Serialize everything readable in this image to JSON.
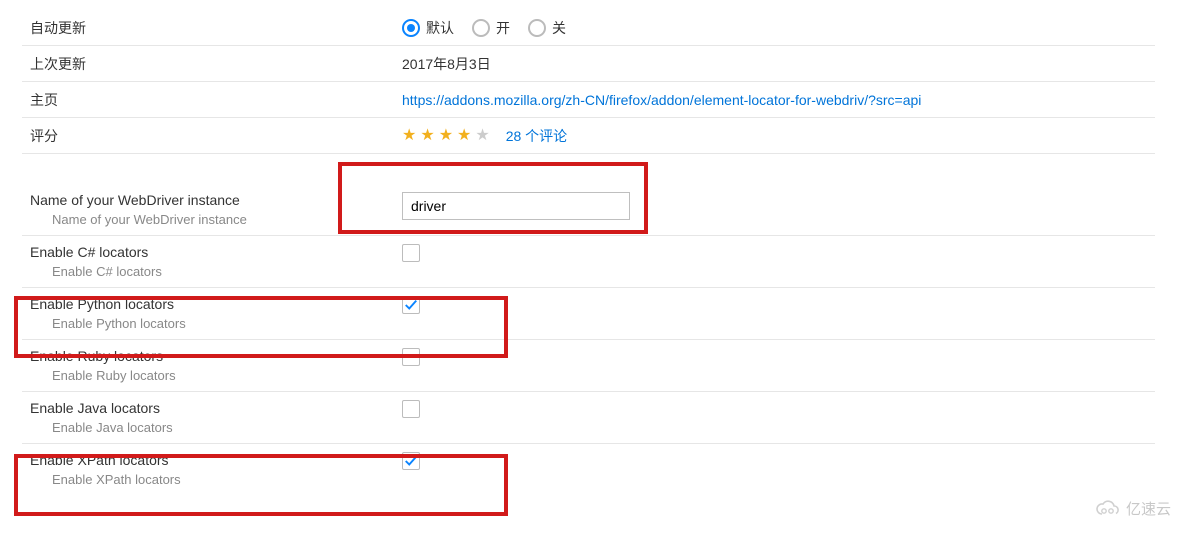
{
  "info": {
    "auto_update_label": "自动更新",
    "radio_default": "默认",
    "radio_on": "开",
    "radio_off": "关",
    "last_update_label": "上次更新",
    "last_update_value": "2017年8月3日",
    "homepage_label": "主页",
    "homepage_url": "https://addons.mozilla.org/zh-CN/firefox/addon/element-locator-for-webdriv/?src=api",
    "rating_label": "评分",
    "rating_stars": 4,
    "reviews_text": "28 个评论"
  },
  "settings": {
    "webdriver_name": {
      "title": "Name of your WebDriver instance",
      "sub": "Name of your WebDriver instance",
      "value": "driver"
    },
    "csharp": {
      "title": "Enable C# locators",
      "sub": "Enable C# locators",
      "checked": false
    },
    "python": {
      "title": "Enable Python locators",
      "sub": "Enable Python locators",
      "checked": true
    },
    "ruby": {
      "title": "Enable Ruby locators",
      "sub": "Enable Ruby locators",
      "checked": false
    },
    "java": {
      "title": "Enable Java locators",
      "sub": "Enable Java locators",
      "checked": false
    },
    "xpath": {
      "title": "Enable XPath locators",
      "sub": "Enable XPath locators",
      "checked": true
    }
  },
  "watermark": "亿速云"
}
